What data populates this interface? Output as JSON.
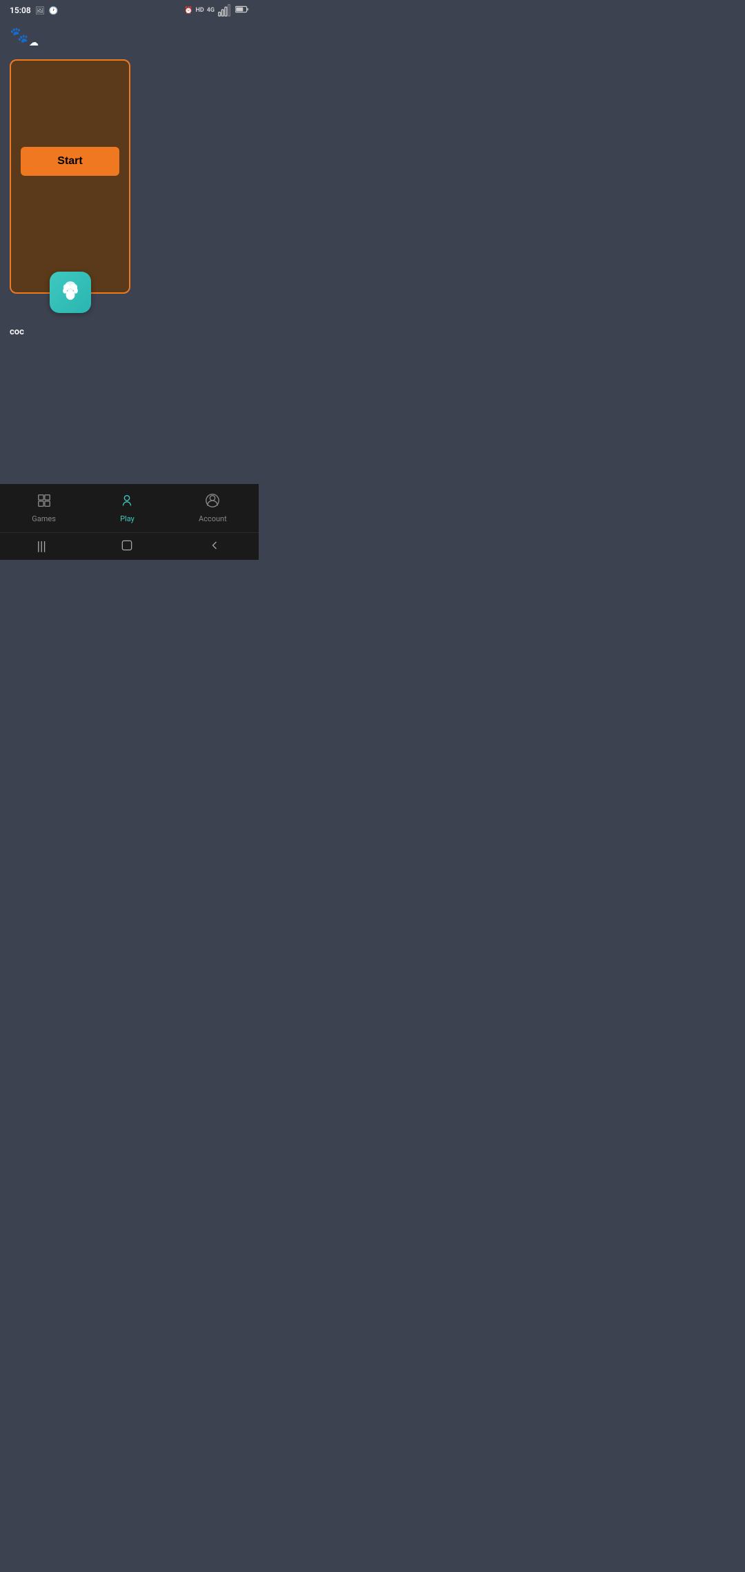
{
  "status_bar": {
    "time": "15:08",
    "icons_left": [
      "photo",
      "clock"
    ],
    "icons_right": [
      "alarm",
      "HD",
      "4G",
      "signal",
      "battery"
    ]
  },
  "app_header": {
    "logo_paw": "🐾",
    "logo_cloud": "☁"
  },
  "game_card": {
    "start_button_label": "Start",
    "app_icon_label": "coc",
    "background_color": "#5a3a1a",
    "border_color": "#f07820"
  },
  "bottom_nav": {
    "items": [
      {
        "id": "games",
        "label": "Games",
        "icon": "games",
        "active": false
      },
      {
        "id": "play",
        "label": "Play",
        "icon": "play",
        "active": true
      },
      {
        "id": "account",
        "label": "Account",
        "icon": "account",
        "active": false
      }
    ]
  },
  "gesture_bar": {
    "icons": [
      "menu",
      "home",
      "back"
    ]
  }
}
